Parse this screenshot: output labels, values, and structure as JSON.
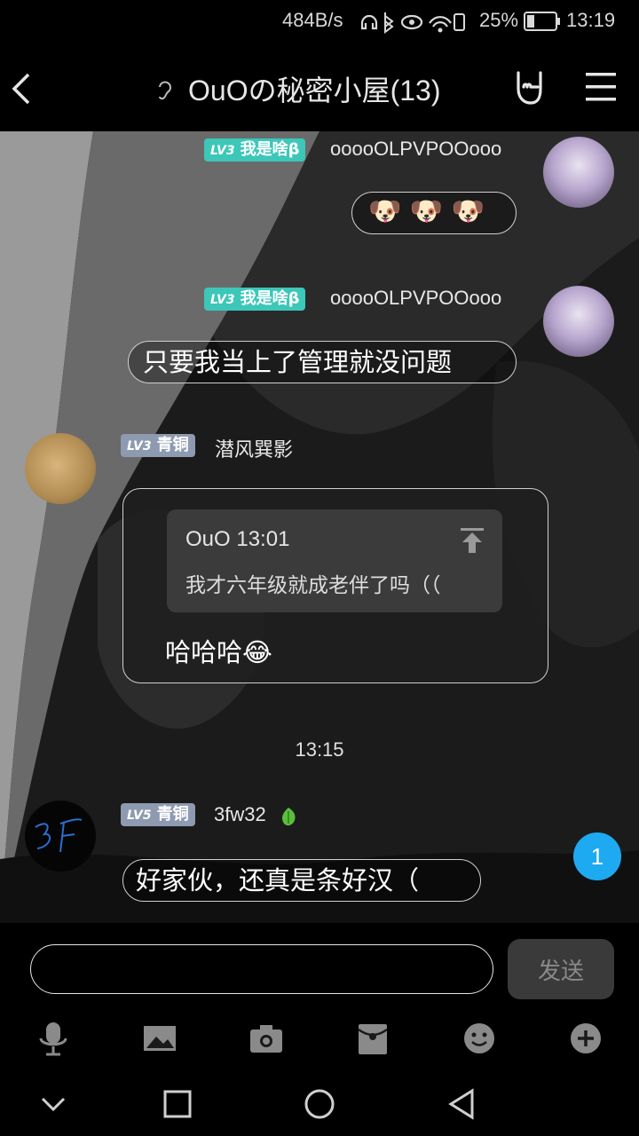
{
  "status_bar": {
    "net_speed": "484B/s",
    "battery": "25%",
    "time": "13:19"
  },
  "header": {
    "title": "OuOの秘密小屋(13)"
  },
  "messages": [
    {
      "badge_level": "LV3",
      "badge_title": "我是啥β",
      "nick": "ooooOLPVPOOooo",
      "content": "🐶 🐶 🐶"
    },
    {
      "badge_level": "LV3",
      "badge_title": "我是啥β",
      "nick": "ooooOLPVPOOooo",
      "content": "只要我当上了管理就没问题"
    },
    {
      "badge_level": "LV3",
      "badge_title": "青铜",
      "nick": "潜风巽影",
      "reply_header": "OuO 13:01",
      "reply_text": "我才六年级就成老伴了吗（（",
      "content": "哈哈哈😂"
    },
    {
      "badge_level": "LV5",
      "badge_title": "青铜",
      "nick": "3fw32",
      "content": "好家伙，还真是条好汉（"
    }
  ],
  "timestamp": "13:15",
  "unread_count": "1",
  "input": {
    "value": "",
    "placeholder": ""
  },
  "send_label": "发送",
  "colors": {
    "badge_teal": "#3cc7b9",
    "badge_gray": "#8e9ab0",
    "unread_blue": "#1eaaf1"
  }
}
